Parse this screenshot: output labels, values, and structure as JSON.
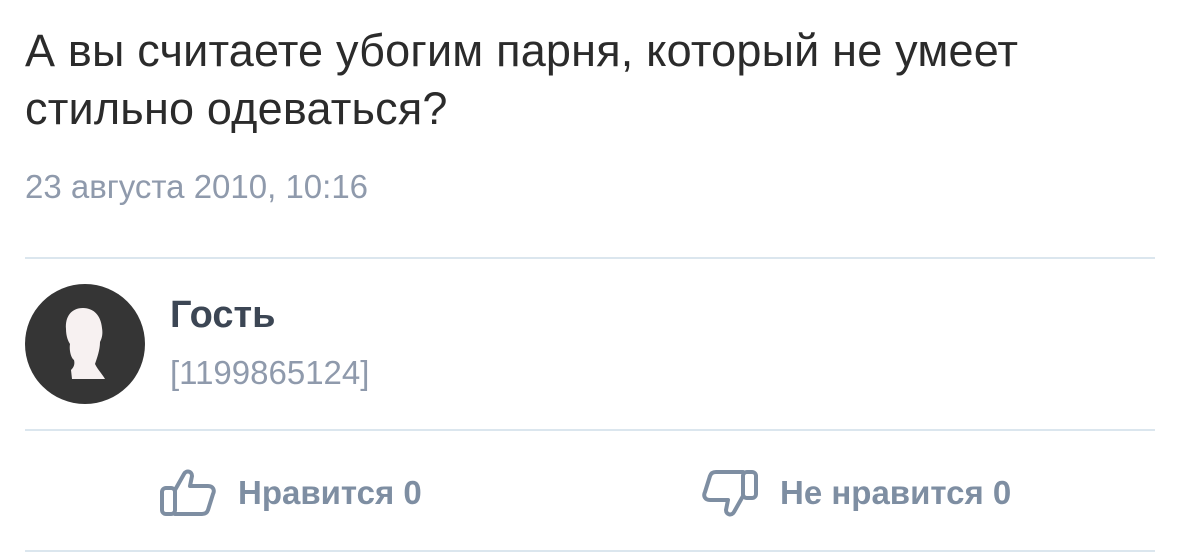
{
  "post": {
    "question": "А вы считаете убогим парня, который не умеет стильно одеваться?",
    "date": "23 августа 2010, 10:16"
  },
  "author": {
    "name": "Гость",
    "id": "[1199865124]",
    "avatar_icon": "user-silhouette-icon"
  },
  "actions": {
    "like_label": "Нравится 0",
    "like_icon": "thumbs-up-icon",
    "dislike_label": "Не нравится 0",
    "dislike_icon": "thumbs-down-icon"
  },
  "colors": {
    "text": "#2b2b2b",
    "muted": "#8f9aac",
    "action": "#7e8ea2",
    "divider": "#dbe6ee",
    "avatar_bg": "#353535"
  }
}
